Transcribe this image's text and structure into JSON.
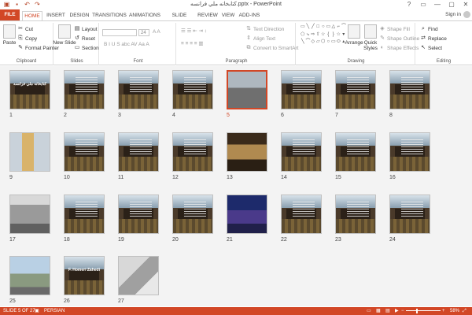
{
  "window": {
    "title": "كتابخانه ملي فرانسه.pptx - PowerPoint",
    "controls": [
      "?",
      "▭",
      "—",
      "▢",
      "✕"
    ]
  },
  "tabs": [
    "FILE",
    "HOME",
    "INSERT",
    "DESIGN",
    "TRANSITIONS",
    "ANIMATIONS",
    "SLIDE SHOW",
    "REVIEW",
    "VIEW",
    "ADD-INS"
  ],
  "active_tab": "HOME",
  "signin": "Sign in",
  "ribbon": {
    "clipboard": {
      "label": "Clipboard",
      "paste": "Paste",
      "cut": "Cut",
      "copy": "Copy",
      "format_painter": "Format Painter"
    },
    "slides": {
      "label": "Slides",
      "new_slide": "New Slide",
      "layout": "Layout",
      "reset": "Reset",
      "section": "Section"
    },
    "font": {
      "label": "Font",
      "size": "24"
    },
    "paragraph": {
      "label": "Paragraph",
      "text_direction": "Text Direction",
      "align_text": "Align Text",
      "convert": "Convert to SmartArt"
    },
    "drawing": {
      "label": "Drawing",
      "arrange": "Arrange",
      "quick_styles": "Quick Styles",
      "shape_fill": "Shape Fill",
      "shape_outline": "Shape Outline",
      "shape_effects": "Shape Effects"
    },
    "editing": {
      "label": "Editing",
      "find": "Find",
      "replace": "Replace",
      "select": "Select"
    }
  },
  "slides": [
    {
      "n": "1",
      "kind": "title",
      "caption": "كتابخانه ملي فرانسه"
    },
    {
      "n": "2",
      "kind": "text"
    },
    {
      "n": "3",
      "kind": "text"
    },
    {
      "n": "4",
      "kind": "text"
    },
    {
      "n": "5",
      "kind": "photo-street"
    },
    {
      "n": "6",
      "kind": "text"
    },
    {
      "n": "7",
      "kind": "text"
    },
    {
      "n": "8",
      "kind": "text"
    },
    {
      "n": "9",
      "kind": "photo-tower"
    },
    {
      "n": "10",
      "kind": "text"
    },
    {
      "n": "11",
      "kind": "text"
    },
    {
      "n": "12",
      "kind": "text"
    },
    {
      "n": "13",
      "kind": "photo-court"
    },
    {
      "n": "14",
      "kind": "text"
    },
    {
      "n": "15",
      "kind": "text"
    },
    {
      "n": "16",
      "kind": "text"
    },
    {
      "n": "17",
      "kind": "photo-building"
    },
    {
      "n": "18",
      "kind": "text"
    },
    {
      "n": "19",
      "kind": "text"
    },
    {
      "n": "20",
      "kind": "text"
    },
    {
      "n": "21",
      "kind": "photo-night"
    },
    {
      "n": "22",
      "kind": "text"
    },
    {
      "n": "23",
      "kind": "text"
    },
    {
      "n": "24",
      "kind": "text"
    },
    {
      "n": "25",
      "kind": "photo-skyline"
    },
    {
      "n": "26",
      "kind": "credits",
      "caption": "F. Homeri Zahedi"
    },
    {
      "n": "27",
      "kind": "photo-laptop"
    }
  ],
  "selected_slide": "5",
  "status": {
    "slide": "SLIDE 5 OF 27",
    "language": "PERSIAN",
    "zoom": "58%",
    "zoom_value": 58
  }
}
